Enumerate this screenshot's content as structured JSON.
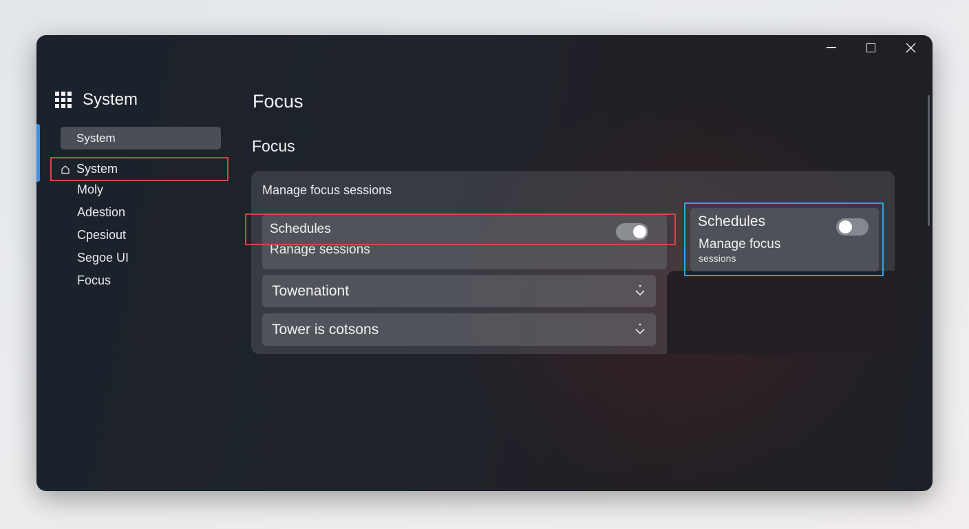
{
  "window": {
    "controls": {
      "minimize": "minimize",
      "maximize": "maximize",
      "close": "close"
    }
  },
  "sidebar": {
    "app_title": "System",
    "search_label": "System",
    "home_label": "System",
    "items": [
      {
        "label": "Moly"
      },
      {
        "label": "Adestion"
      },
      {
        "label": "Cpesiout"
      },
      {
        "label": "Segoe UI"
      },
      {
        "label": "Focus"
      }
    ]
  },
  "main": {
    "page_title": "Focus",
    "section_title": "Focus",
    "card": {
      "label": "Manage focus sessions",
      "schedules": {
        "title": "Schedules",
        "subtitle": "Ranage sessions",
        "toggle_state": "on"
      },
      "dropdowns": [
        {
          "label": "Towenationt"
        },
        {
          "label": "Tower is cotsons"
        }
      ]
    },
    "popup": {
      "title": "Schedules",
      "subtitle_line1": "Manage focus",
      "subtitle_line2": "sessions",
      "toggle_state": "off"
    }
  },
  "colors": {
    "accent": "#3f8fe6",
    "highlight_red": "#d6473f",
    "highlight_blue": "#29a7e4"
  },
  "icons": {
    "app": "grid-icon",
    "home": "home-icon",
    "dropdown": "chevron-down-icon"
  }
}
